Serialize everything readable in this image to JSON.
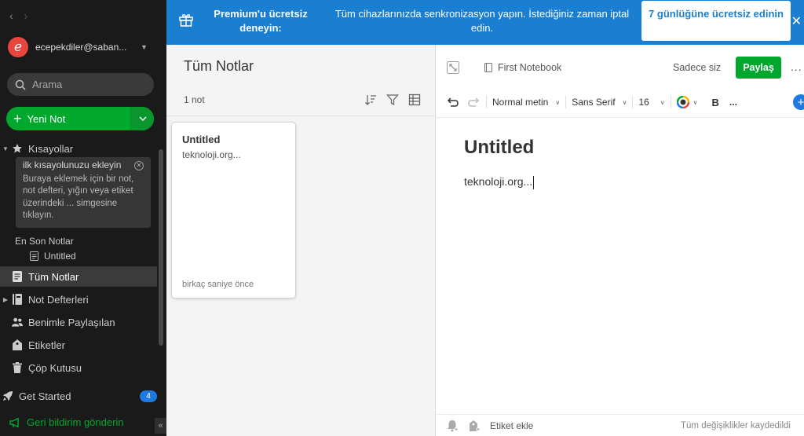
{
  "sidebar": {
    "account": {
      "initial": "e",
      "email": "ecepekdiler@saban..."
    },
    "search": {
      "placeholder": "Arama"
    },
    "new_note": {
      "label": "Yeni Not"
    },
    "shortcuts": {
      "label": "Kısayollar",
      "hint_title": "ilk kısayolunuzu ekleyin",
      "hint_body": "Buraya eklemek için bir not, not defteri, yığın veya etiket üzerindeki ... simgesine tıklayın."
    },
    "recent": {
      "title": "En Son Notlar",
      "items": [
        "Untitled"
      ]
    },
    "items": [
      {
        "label": "Tüm Notlar"
      },
      {
        "label": "Not Defterleri"
      },
      {
        "label": "Benimle Paylaşılan"
      },
      {
        "label": "Etiketler"
      },
      {
        "label": "Çöp Kutusu"
      }
    ],
    "get_started": {
      "label": "Get Started",
      "badge": "4"
    },
    "feedback": {
      "label": "Geri bildirim gönderin"
    },
    "collapse": "«"
  },
  "banner": {
    "premium": "Premium'u ücretsiz deneyin:",
    "sync": "Tüm cihazlarınızda senkronizasyon yapın. İstediğiniz zaman iptal edin.",
    "cta": "7 günlüğüne ücretsiz edinin",
    "close": "✕"
  },
  "note_list": {
    "title": "Tüm Notlar",
    "count": "1 not",
    "notes": [
      {
        "title": "Untitled",
        "snippet": "teknoloji.org...",
        "time": "birkaç saniye önce"
      }
    ]
  },
  "editor": {
    "notebook": "First Notebook",
    "visibility": "Sadece siz",
    "share_label": "Paylaş",
    "more": "...",
    "toolbar": {
      "style": "Normal metin",
      "font": "Sans Serif",
      "size": "16",
      "bold": "B",
      "more": "..."
    },
    "title": "Untitled",
    "body": "teknoloji.org...",
    "add_tag": "Etiket ekle",
    "status": "Tüm değişiklikler kaydedildi"
  },
  "colors": {
    "accent_green": "#00a82d",
    "banner_blue": "#1a7fd1",
    "sidebar_bg": "#1a1a1a"
  }
}
